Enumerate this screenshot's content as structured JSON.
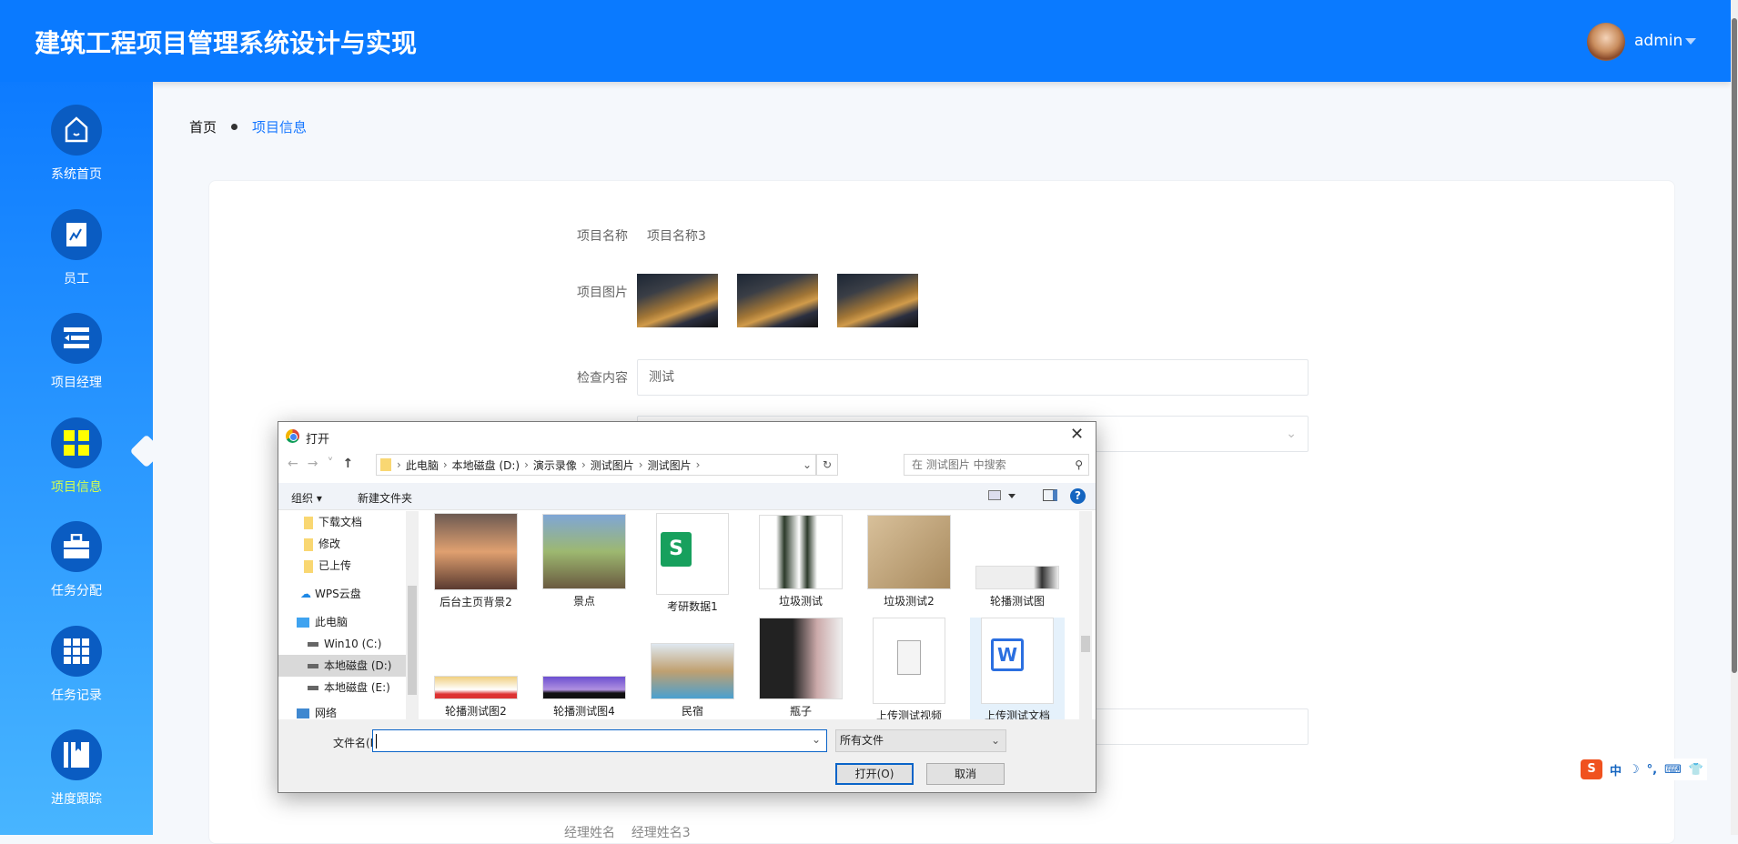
{
  "header": {
    "title": "建筑工程项目管理系统设计与实现",
    "user": "admin"
  },
  "sidebar": {
    "items": [
      {
        "label": "系统首页",
        "icon": "home-icon"
      },
      {
        "label": "员工",
        "icon": "chart-icon"
      },
      {
        "label": "项目经理",
        "icon": "list-icon"
      },
      {
        "label": "项目信息",
        "icon": "grid-icon",
        "active": true
      },
      {
        "label": "任务分配",
        "icon": "briefcase-icon"
      },
      {
        "label": "任务记录",
        "icon": "table-icon"
      },
      {
        "label": "进度跟踪",
        "icon": "book-icon"
      }
    ]
  },
  "breadcrumb": {
    "home": "首页",
    "current": "项目信息"
  },
  "form": {
    "name_label": "项目名称",
    "name_value": "项目名称3",
    "image_label": "项目图片",
    "check_label": "检查内容",
    "check_value": "测试",
    "manager_label": "经理姓名",
    "manager_value": "经理姓名3"
  },
  "dialog": {
    "title": "打开",
    "path": [
      "此电脑",
      "本地磁盘 (D:)",
      "演示录像",
      "测试图片",
      "测试图片"
    ],
    "search_placeholder": "在 测试图片 中搜索",
    "organize": "组织 ▾",
    "new_folder": "新建文件夹",
    "nav": [
      {
        "label": "下载文档",
        "type": "folder"
      },
      {
        "label": "修改",
        "type": "folder"
      },
      {
        "label": "已上传",
        "type": "folder"
      },
      {
        "label": "WPS云盘",
        "type": "cloud"
      },
      {
        "label": "此电脑",
        "type": "pc"
      },
      {
        "label": "Win10 (C:)",
        "type": "drive"
      },
      {
        "label": "本地磁盘 (D:)",
        "type": "drive",
        "selected": true
      },
      {
        "label": "本地磁盘 (E:)",
        "type": "drive"
      },
      {
        "label": "网络",
        "type": "network"
      }
    ],
    "files": [
      {
        "name": "后台主页背景2",
        "kind": "image"
      },
      {
        "name": "景点",
        "kind": "image"
      },
      {
        "name": "考研数据1",
        "kind": "spreadsheet"
      },
      {
        "name": "垃圾测试",
        "kind": "image"
      },
      {
        "name": "垃圾测试2",
        "kind": "image"
      },
      {
        "name": "轮播测试图",
        "kind": "image"
      },
      {
        "name": "轮播测试图2",
        "kind": "image"
      },
      {
        "name": "轮播测试图4",
        "kind": "image"
      },
      {
        "name": "民宿",
        "kind": "image"
      },
      {
        "name": "瓶子",
        "kind": "image"
      },
      {
        "name": "上传测试视频",
        "kind": "blank"
      },
      {
        "name": "上传测试文档",
        "kind": "word",
        "selected": true
      }
    ],
    "filename_label": "文件名(N):",
    "filename_value": "",
    "filetype": "所有文件",
    "open": "打开(O)",
    "cancel": "取消"
  },
  "ime": {
    "mode": "中"
  }
}
